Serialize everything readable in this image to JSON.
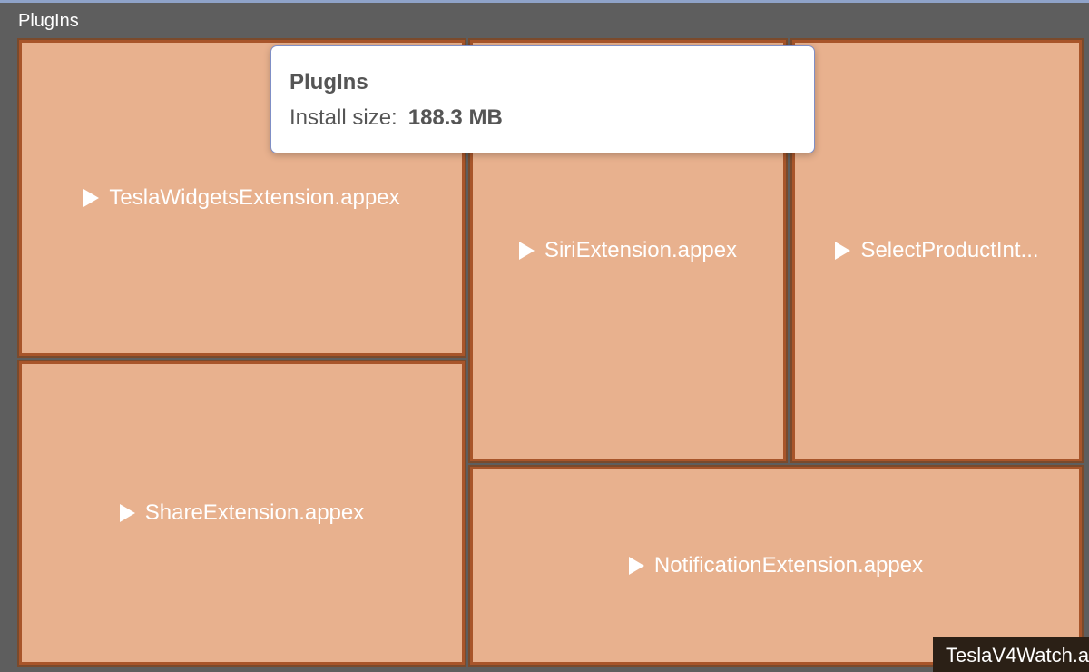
{
  "root": {
    "title": "PlugIns"
  },
  "tiles": {
    "widgets": "TeslaWidgetsExtension.appex",
    "siri": "SiriExtension.appex",
    "select_product": "SelectProductInt...",
    "share": "ShareExtension.appex",
    "notification": "NotificationExtension.appex"
  },
  "tooltip": {
    "title": "PlugIns",
    "size_label": "Install size:",
    "size_value": "188.3 MB"
  },
  "neighbor": {
    "label": "TeslaV4Watch.a"
  },
  "colors": {
    "tile_fill": "#e8b18e",
    "tile_border": "#a8552a",
    "background": "#5e5e5e"
  },
  "icons": {
    "expand": "triangle-right-icon"
  }
}
